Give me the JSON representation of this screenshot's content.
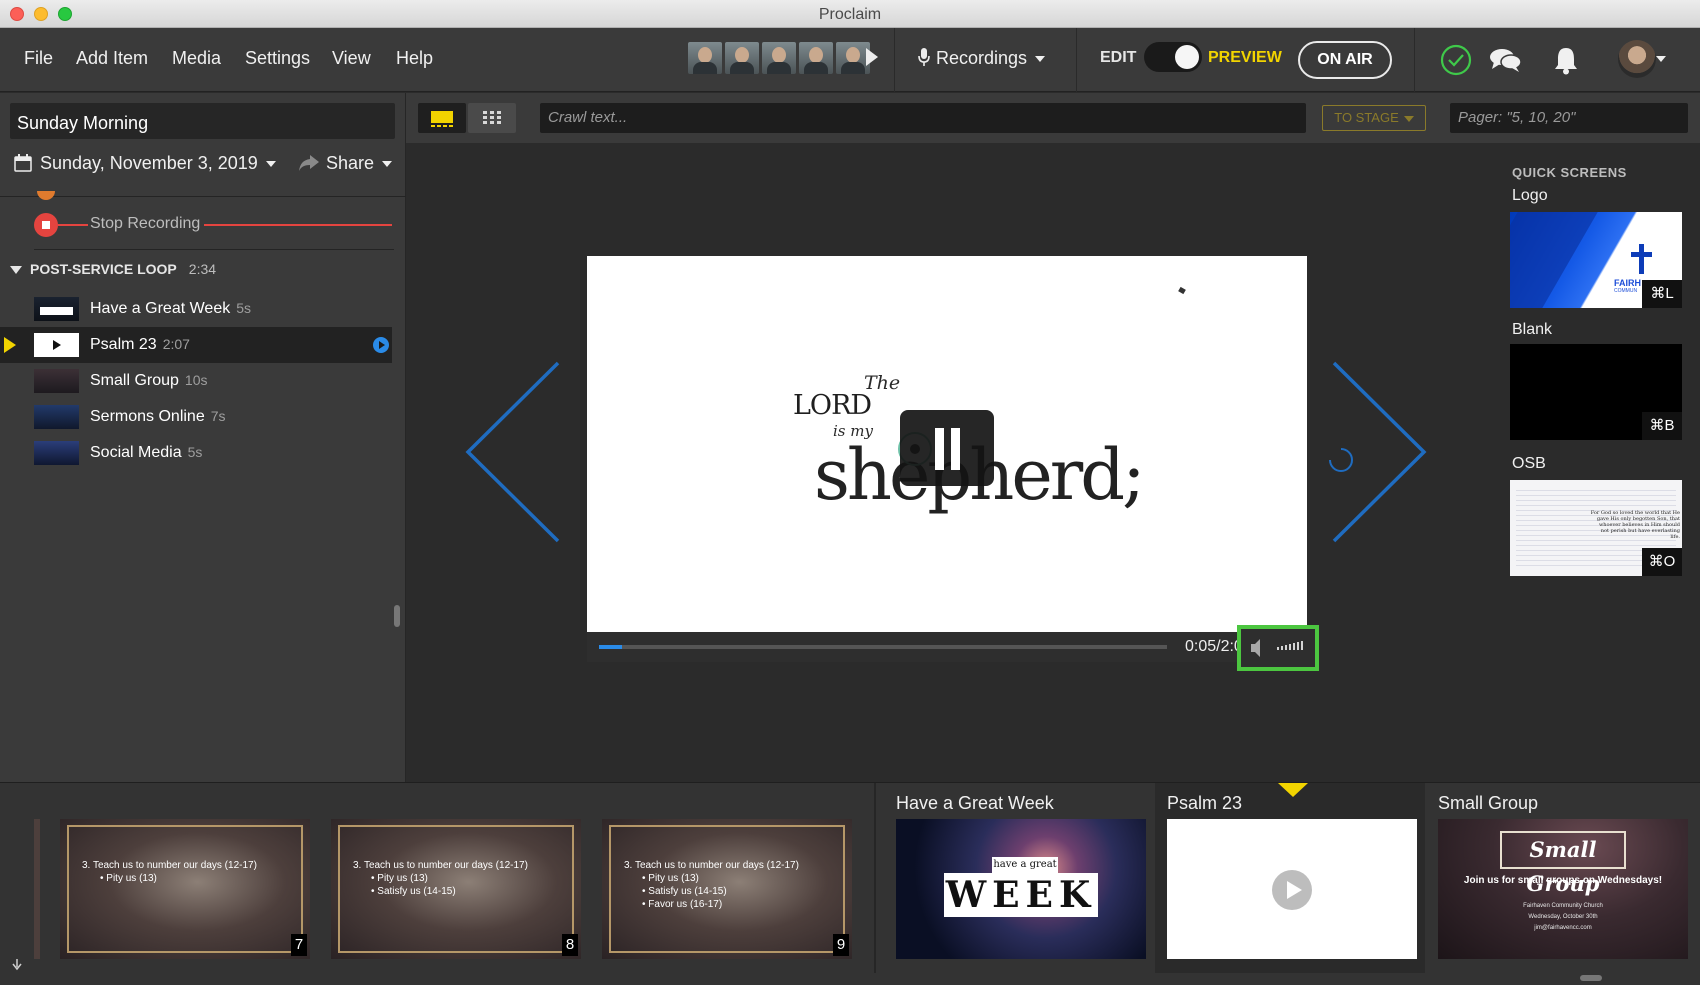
{
  "window": {
    "title": "Proclaim"
  },
  "menu": {
    "file": "File",
    "add_item": "Add Item",
    "media": "Media",
    "settings": "Settings",
    "view": "View",
    "help": "Help"
  },
  "toolbar": {
    "recordings_label": "Recordings",
    "edit_label": "EDIT",
    "preview_label": "PREVIEW",
    "on_air_label": "ON AIR",
    "preview_color": "#f2d400"
  },
  "service": {
    "name": "Sunday Morning",
    "date": "Sunday, November 3, 2019",
    "share_label": "Share",
    "stop_recording_label": "Stop Recording",
    "section": {
      "name": "POST-SERVICE LOOP",
      "duration": "2:34"
    },
    "items": [
      {
        "label": "Have a Great Week",
        "duration": "5s",
        "selected": false
      },
      {
        "label": "Psalm 23",
        "duration": "2:07",
        "selected": true
      },
      {
        "label": "Small Group",
        "duration": "10s",
        "selected": false
      },
      {
        "label": "Sermons Online",
        "duration": "7s",
        "selected": false
      },
      {
        "label": "Social Media",
        "duration": "5s",
        "selected": false
      }
    ]
  },
  "crawl": {
    "placeholder": "Crawl text...",
    "to_stage_label": "TO STAGE",
    "pager_placeholder": "Pager: \"5, 10, 20\""
  },
  "stage": {
    "slide_text": {
      "the": "The",
      "lord": "LORD",
      "is_my": "is my",
      "shepherd": "shepherd;"
    },
    "time": "0:05/2:0",
    "progress": 0.04
  },
  "quick_screens": {
    "header": "QUICK SCREENS",
    "items": [
      {
        "name": "Logo",
        "shortcut": "⌘L",
        "logo_text": "FAIRH",
        "logo_subtext": "COMMUN"
      },
      {
        "name": "Blank",
        "shortcut": "⌘B"
      },
      {
        "name": "OSB",
        "shortcut": "⌘O",
        "verse_text": "For God so loved the world that He gave His only begotten Son, that whoever believes in Him should not perish but have everlasting life."
      }
    ]
  },
  "strip": {
    "slides": [
      {
        "number": "7",
        "line1": "3. Teach us to number our days (12-17)",
        "bullets": [
          "Pity us (13)"
        ]
      },
      {
        "number": "8",
        "line1": "3. Teach us to number our days (12-17)",
        "bullets": [
          "Pity us (13)",
          "Satisfy us (14-15)"
        ]
      },
      {
        "number": "9",
        "line1": "3. Teach us to number our days (12-17)",
        "bullets": [
          "Pity us (13)",
          "Satisfy us (14-15)",
          "Favor us (16-17)"
        ]
      }
    ],
    "items": [
      {
        "title": "Have a Great Week",
        "line1": "have a great",
        "line2": "WEEK"
      },
      {
        "title": "Psalm 23"
      },
      {
        "title": "Small Group",
        "heading": "Small Group",
        "subtitle": "Join us for small groups on Wednesdays!",
        "church": "Fairhaven Community Church",
        "date": "Wednesday, October 30th",
        "email": "jim@fairhavencc.com"
      }
    ]
  },
  "colors": {
    "accent_blue": "#2a8be8",
    "record_red": "#e5443f",
    "highlight_green": "#4cc640",
    "chevron_blue": "#1f6cc0"
  }
}
